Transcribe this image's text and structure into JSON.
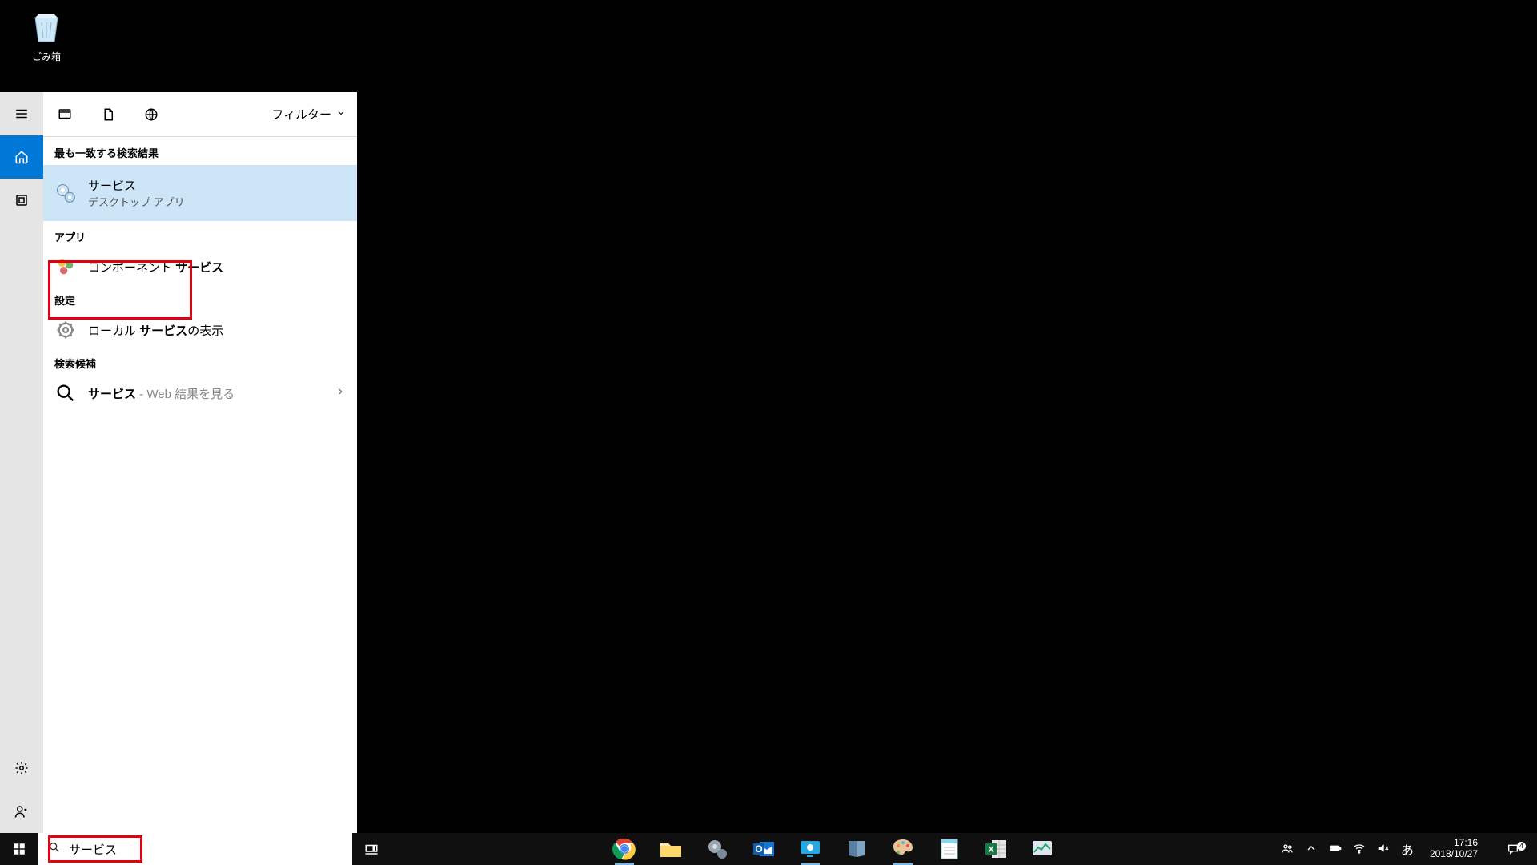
{
  "desktop": {
    "recycle_bin_label": "ごみ箱"
  },
  "panel": {
    "filter_label": "フィルター",
    "sections": {
      "best_match": "最も一致する検索結果",
      "apps": "アプリ",
      "settings": "設定",
      "suggestions": "検索候補"
    },
    "best": {
      "title": "サービス",
      "subtitle": "デスクトップ アプリ"
    },
    "app_result_prefix": "コンポーネント ",
    "app_result_bold": "サービス",
    "setting_prefix": "ローカル ",
    "setting_bold": "サービス",
    "setting_suffix": "の表示",
    "suggestion_bold": "サービス",
    "suggestion_suffix": " - Web 結果を見る"
  },
  "search": {
    "query": "サービス"
  },
  "tray": {
    "ime": "あ",
    "time": "17:16",
    "date": "2018/10/27",
    "notif_count": "4"
  },
  "colors": {
    "accent": "#0078d7",
    "highlight_red": "#e3000f",
    "best_bg": "#cde6f7"
  }
}
